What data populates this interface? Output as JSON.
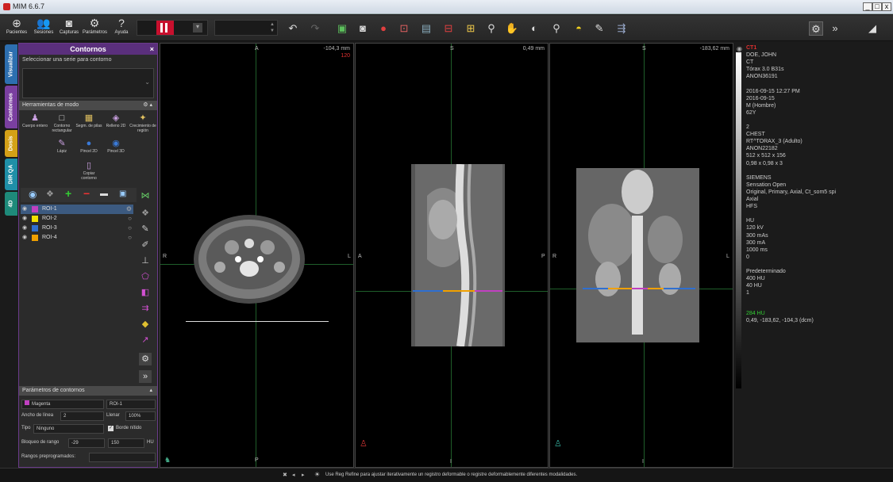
{
  "window": {
    "title": "MIM 6.6.7",
    "controls": [
      "_",
      "□",
      "x"
    ]
  },
  "toolbar": {
    "main": [
      {
        "label": "Pacientes",
        "icon": "patient-icon"
      },
      {
        "label": "Sesiones",
        "icon": "sessions-icon"
      },
      {
        "label": "Capturas",
        "icon": "camera-icon"
      },
      {
        "label": "Parámetros",
        "icon": "gear-icon"
      },
      {
        "label": "Ayuda",
        "icon": "help-icon"
      }
    ],
    "brand_color": "#c8102e"
  },
  "left_tabs": [
    {
      "label": "Visualizar",
      "color": "#2d6fb0"
    },
    {
      "label": "Contornos",
      "color": "#7a3fa0"
    },
    {
      "label": "Dosis",
      "color": "#d4a017"
    },
    {
      "label": "DIR QA",
      "color": "#1f8fa8"
    },
    {
      "label": "4D",
      "color": "#1e8a7a"
    }
  ],
  "panel": {
    "title": "Contornos",
    "close": "×",
    "series_label": "Seleccionar una serie para contorno",
    "tools_header": "Herramientas de modo",
    "tools": [
      {
        "label": "Cuerpo entero",
        "icon": "body-icon"
      },
      {
        "label": "Contorno rectangular",
        "icon": "rectangle-icon"
      },
      {
        "label": "Segm. de pilas",
        "icon": "stack-icon"
      },
      {
        "label": "Relleno 2D",
        "icon": "fill-icon"
      },
      {
        "label": "Crecimiento de región",
        "icon": "region-grow-icon"
      },
      {
        "label": "Lápiz",
        "icon": "pencil-icon"
      },
      {
        "label": "Pincel 2D",
        "icon": "brush-2d-icon"
      },
      {
        "label": "Pincel 3D",
        "icon": "brush-3d-icon"
      },
      {
        "label": "Copiar contorno",
        "icon": "copy-contour-icon"
      }
    ],
    "rois": [
      {
        "name": "ROI-1",
        "color": "#c040c0",
        "selected": true
      },
      {
        "name": "ROI-2",
        "color": "#f0e000"
      },
      {
        "name": "ROI-3",
        "color": "#2f6fd0"
      },
      {
        "name": "ROI-4",
        "color": "#f0a000"
      }
    ],
    "params_header": "Parámetros de contornos",
    "params": {
      "color": "Magenta",
      "roi_name": "ROI-1",
      "line_width_label": "Ancho de línea",
      "line_width": "2",
      "fill_label": "Llenar",
      "fill": "100%",
      "type_label": "Tipo",
      "type": "Ninguno",
      "sharp_label": "Borde nítido",
      "range_label": "Bloqueo de rango",
      "range_min": "-29",
      "range_max": "150",
      "range_unit": "HU",
      "presets_label": "Rangos preprogramados:"
    }
  },
  "viewports": [
    {
      "top": "A",
      "bottom": "P",
      "left": "R",
      "right": "L",
      "position": "-104,3 mm",
      "slice": "120"
    },
    {
      "top": "S",
      "bottom": "I",
      "left": "A",
      "right": "P",
      "position": "0,49 mm",
      "slice": ""
    },
    {
      "top": "S",
      "bottom": "I",
      "left": "R",
      "right": "L",
      "position": "-183,62 mm",
      "slice": ""
    }
  ],
  "info": {
    "series": "CT1",
    "lines": [
      "DOE, JOHN",
      "CT",
      "Tórax 3.0 B31s",
      "ANON36191",
      "",
      "2016-09-15 12:27 PM",
      "2016-09-15",
      "M (Hombre)",
      "62Y",
      "",
      "2",
      "CHEST",
      "RT^TORAX_3 (Adulto)",
      "ANON22182",
      "512 x 512 x 156",
      "0,98 x 0,98 x 3",
      "",
      "SIEMENS",
      "Sensation Open",
      "Original, Primary, Axial, Ct_som5 spi",
      "Axial",
      "HFS",
      "",
      "HU",
      "120 kV",
      "300 mAs",
      "300 mA",
      "1000 ms",
      "0",
      "",
      "Predeterminado",
      "400 HU",
      "40 HU",
      "1"
    ],
    "value_green": "284 HU",
    "coords": "0,49, -183,62, -104,3 (dcm)"
  },
  "status": {
    "text": "Use Reg Refine para ajustar iterativamente un registro deformable o registre deformablemente diferentes modalidades."
  }
}
